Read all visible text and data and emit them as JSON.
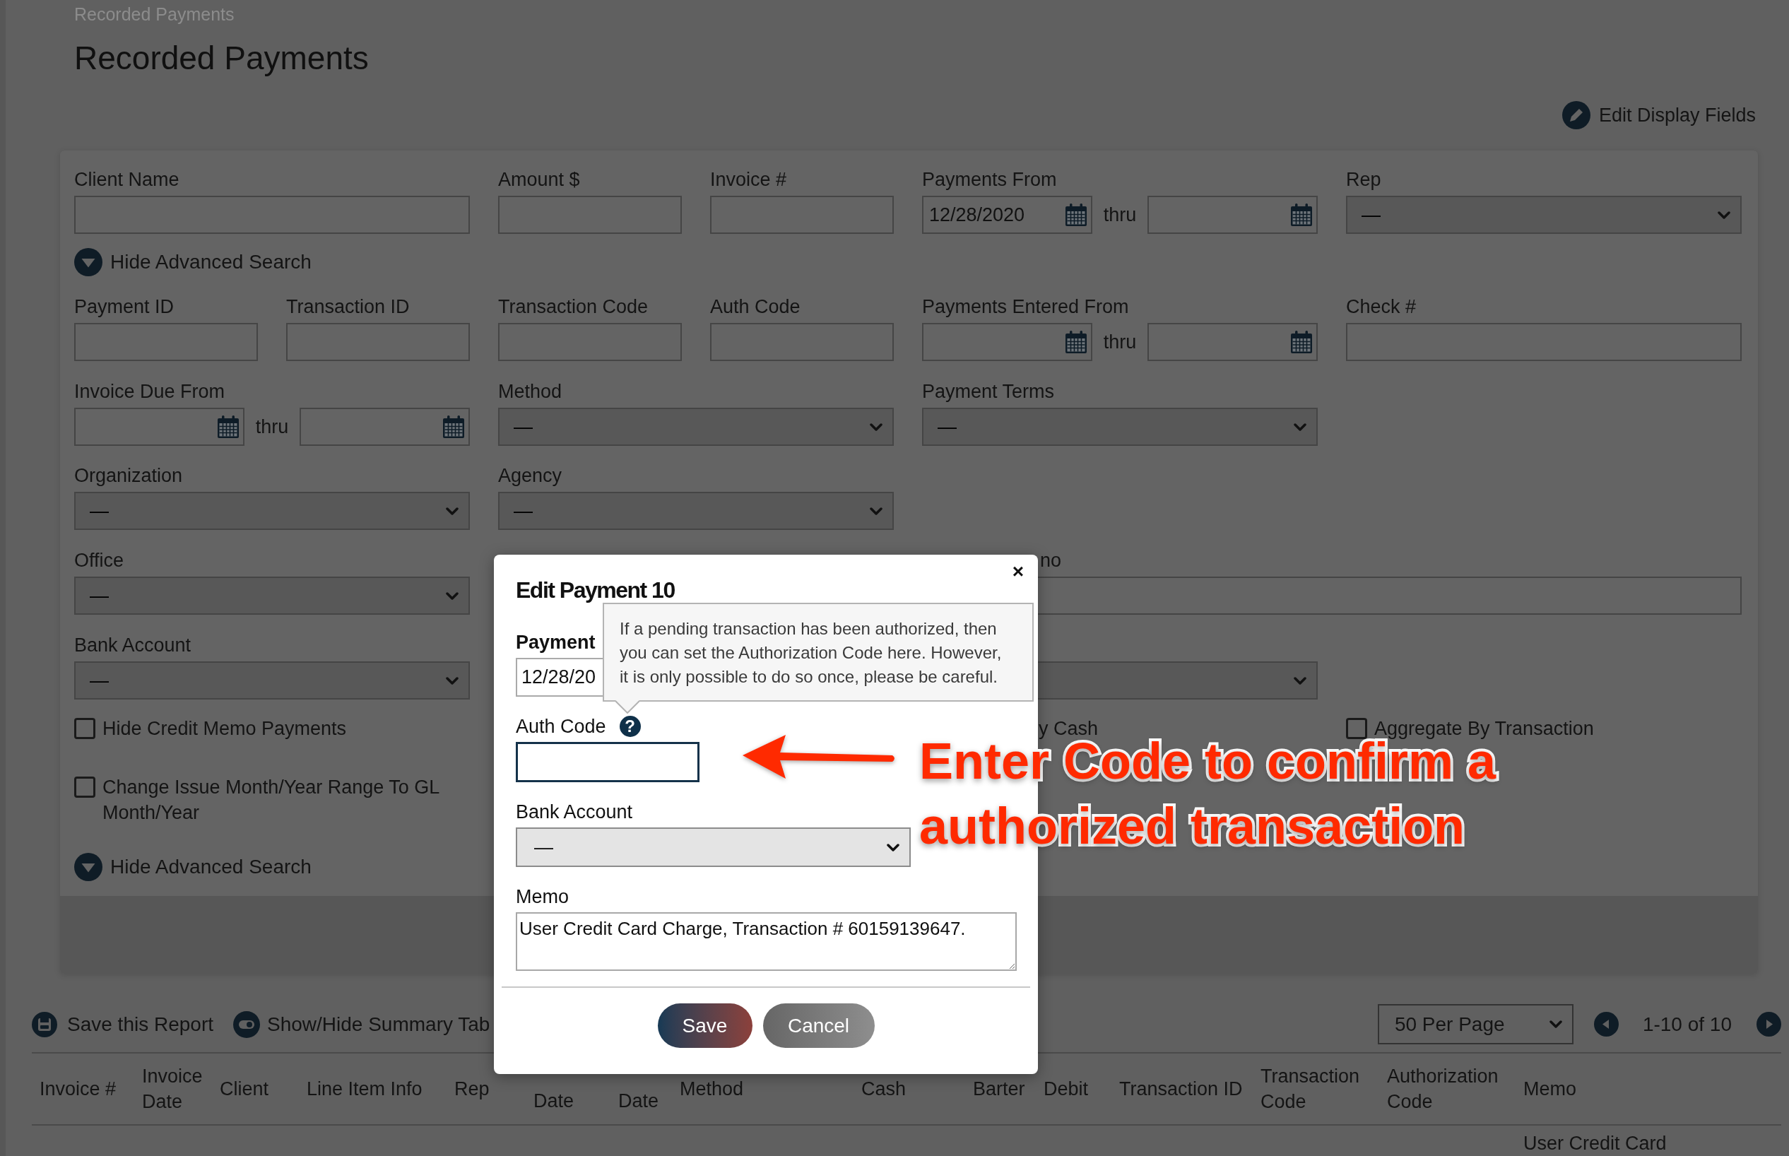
{
  "breadcrumb": "Recorded Payments",
  "page_title": "Recorded Payments",
  "edit_display_fields": "Edit Display Fields",
  "search_panel": {
    "sections": [
      {
        "kind": "fields",
        "fields": [
          {
            "kind": "text",
            "label": "Client Name"
          },
          {
            "kind": "text",
            "label": "Amount $"
          },
          {
            "kind": "text",
            "label": "Invoice #"
          },
          {
            "kind": "date_range",
            "label": "Payments From",
            "from": "12/28/2020",
            "separator": "thru"
          },
          {
            "kind": "select",
            "label": "Rep",
            "value": "—"
          }
        ]
      },
      {
        "kind": "toggle",
        "label": "Hide Advanced Search",
        "expanded": true
      },
      {
        "kind": "fields",
        "fields": [
          {
            "kind": "text",
            "label": "Payment ID"
          },
          {
            "kind": "text",
            "label": "Transaction ID"
          },
          {
            "kind": "text",
            "label": "Transaction Code"
          },
          {
            "kind": "text",
            "label": "Auth Code"
          },
          {
            "kind": "date_range",
            "label": "Payments Entered From",
            "separator": "thru"
          },
          {
            "kind": "text",
            "label": "Check #"
          }
        ]
      },
      {
        "kind": "fields",
        "fields": [
          {
            "kind": "date_range",
            "label": "Invoice Due From",
            "separator": "thru"
          },
          {
            "kind": "select",
            "label": "Method",
            "value": "—"
          },
          {
            "kind": "select",
            "label": "Payment Terms",
            "value": "—"
          }
        ]
      },
      {
        "kind": "fields",
        "fields": [
          {
            "kind": "select",
            "label": "Organization",
            "value": "—"
          },
          {
            "kind": "select",
            "label": "Agency",
            "value": "—"
          }
        ]
      },
      {
        "kind": "fields",
        "fields": [
          {
            "kind": "select",
            "label": "Office",
            "value": "—"
          },
          {
            "kind": "text",
            "label": "no"
          }
        ]
      },
      {
        "kind": "fields",
        "fields": [
          {
            "kind": "select",
            "label": "Bank Account",
            "value": "—"
          },
          {
            "kind": "select"
          }
        ]
      },
      {
        "kind": "checkboxes",
        "items": [
          {
            "kind": "checkbox",
            "label": "Hide Credit Memo Payments",
            "checked": false
          },
          {
            "kind": "label",
            "label": "y Cash"
          },
          {
            "kind": "checkbox",
            "label": "Aggregate By Transaction",
            "checked": false
          }
        ]
      },
      {
        "kind": "checkboxes",
        "items": [
          {
            "kind": "checkbox",
            "label": "Change Issue Month/Year Range To GL Month/Year",
            "checked": false
          }
        ]
      },
      {
        "kind": "toggle",
        "label": "Hide Advanced Search",
        "expanded": true
      }
    ]
  },
  "toolbar": {
    "actions": [
      {
        "kind": "save",
        "label": "Save this Report"
      },
      {
        "kind": "summary",
        "label": "Show/Hide Summary Tab"
      }
    ],
    "page_size": "50 Per Page",
    "range": "1-10 of 10"
  },
  "table": {
    "columns": [
      "Invoice #",
      "Invoice Date",
      "Client",
      "Line Item Info",
      "Rep",
      "Date",
      "Date",
      "Method",
      "Cash",
      "Barter",
      "Debit",
      "Transaction ID",
      "Transaction Code",
      "Authorization Code",
      "Memo"
    ],
    "rows": [
      {
        "memo": "User Credit Card"
      }
    ]
  },
  "dialog": {
    "title": "Edit Payment 10",
    "close": "×",
    "tooltip": "If a pending transaction has been authorized, then you can set the Authorization Code here. However, it is only possible to do so once, please be careful.",
    "fields": [
      {
        "kind": "date",
        "label": "Payment",
        "value": "12/28/20"
      },
      {
        "kind": "text",
        "label": "Auth Code",
        "help": "?",
        "focused": true
      },
      {
        "kind": "select",
        "label": "Bank Account",
        "value": "—"
      },
      {
        "kind": "textarea",
        "label": "Memo",
        "value": "User Credit Card Charge, Transaction # 60159139647."
      }
    ],
    "buttons": [
      {
        "kind": "primary",
        "label": "Save"
      },
      {
        "kind": "secondary",
        "label": "Cancel"
      }
    ]
  },
  "annotation": {
    "lines": [
      "Enter Code to confirm a",
      "authorized transaction"
    ]
  }
}
